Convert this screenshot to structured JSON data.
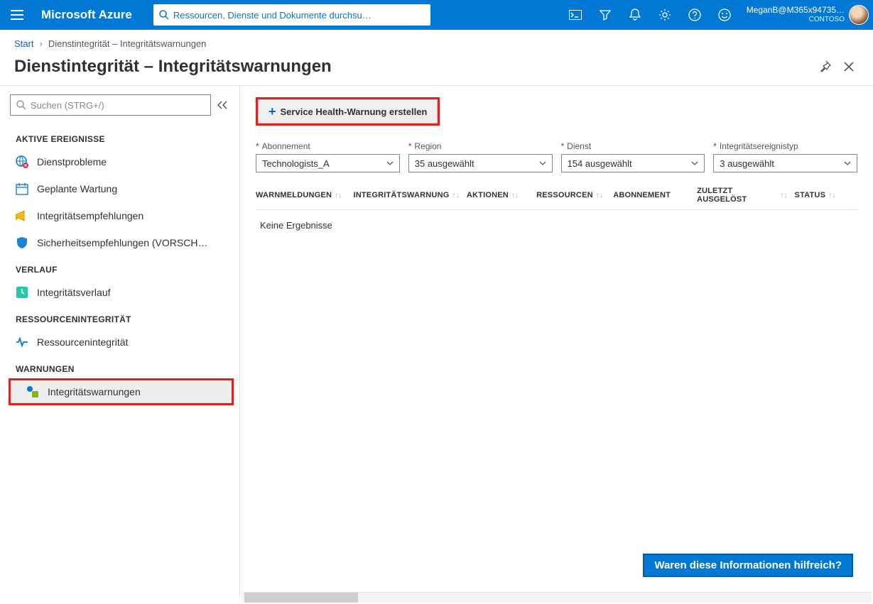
{
  "topbar": {
    "brand": "Microsoft Azure",
    "search_placeholder": "Ressourcen, Dienste und Dokumente durchsu…",
    "user_name": "MeganB@M365x94735…",
    "tenant": "CONTOSO"
  },
  "breadcrumb": {
    "root": "Start",
    "current": "Dienstintegrität – Integritätswarnungen"
  },
  "page": {
    "title": "Dienstintegrität – Integritätswarnungen"
  },
  "sidebar": {
    "search_placeholder": "Suchen (STRG+/)",
    "sections": [
      {
        "heading": "AKTIVE EREIGNISSE",
        "items": [
          {
            "label": "Dienstprobleme"
          },
          {
            "label": "Geplante Wartung"
          },
          {
            "label": "Integritätsempfehlungen"
          },
          {
            "label": "Sicherheitsempfehlungen (VORSCH…"
          }
        ]
      },
      {
        "heading": "VERLAUF",
        "items": [
          {
            "label": "Integritätsverlauf"
          }
        ]
      },
      {
        "heading": "RESSOURCENINTEGRITÄT",
        "items": [
          {
            "label": "Ressourcenintegrität"
          }
        ]
      },
      {
        "heading": "WARNUNGEN",
        "items": [
          {
            "label": "Integritätswarnungen"
          }
        ]
      }
    ]
  },
  "toolbar": {
    "create_alert_label": "Service Health-Warnung erstellen"
  },
  "filters": [
    {
      "label": "Abonnement",
      "value": "Technologists_A"
    },
    {
      "label": "Region",
      "value": "35 ausgewählt"
    },
    {
      "label": "Dienst",
      "value": "154 ausgewählt"
    },
    {
      "label": "Integritätsereignistyp",
      "value": "3 ausgewählt"
    }
  ],
  "table": {
    "columns": [
      "WARNMELDUNGEN",
      "INTEGRITÄTSWARNUNG",
      "AKTIONEN",
      "RESSOURCEN",
      "ABONNEMENT",
      "ZULETZT AUSGELÖST",
      "STATUS"
    ],
    "no_results": "Keine Ergebnisse"
  },
  "feedback": {
    "prompt": "Waren diese Informationen hilfreich?"
  }
}
